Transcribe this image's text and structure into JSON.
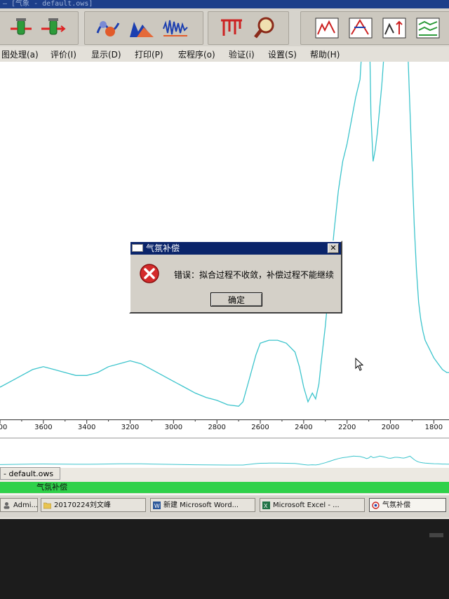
{
  "window": {
    "title": "— [气象 - default.ows]"
  },
  "menu": [
    {
      "label": "图处理(a)"
    },
    {
      "label": "评价(I)"
    },
    {
      "label": "显示(D)"
    },
    {
      "label": "打印(P)"
    },
    {
      "label": "宏程序(o)"
    },
    {
      "label": "验证(i)"
    },
    {
      "label": "设置(S)"
    },
    {
      "label": "帮助(H)"
    }
  ],
  "toolbar_icons": [
    "flask-icon",
    "flask-arrow-icon",
    "spectrum-cloud-icon",
    "spectrum-peaks-icon",
    "spectrum-noise-icon",
    "peaks-bars-icon",
    "magnifier-icon",
    "chart-icon",
    "chart-peak-icon",
    "chart-arrows-icon",
    "chart-stack-icon"
  ],
  "chart_data": {
    "type": "line",
    "xlabel": "",
    "ylabel": "",
    "x_ticks": [
      3600,
      3400,
      3200,
      3000,
      2800,
      2600,
      2400,
      2200,
      2000,
      1800
    ],
    "x_ticks_visible": [
      "00",
      "3600",
      "3400",
      "3200",
      "3000",
      "2800",
      "2600",
      "2400",
      "2200",
      "2000",
      "1800"
    ],
    "xlim": [
      3800,
      1730
    ],
    "axis_reversed": true,
    "series": [
      {
        "color": "#3cc4cc",
        "x": [
          3800,
          3750,
          3700,
          3650,
          3600,
          3550,
          3500,
          3450,
          3400,
          3350,
          3300,
          3250,
          3200,
          3150,
          3100,
          3050,
          3000,
          2950,
          2900,
          2850,
          2800,
          2750,
          2700,
          2680,
          2650,
          2620,
          2600,
          2560,
          2520,
          2480,
          2440,
          2420,
          2400,
          2380,
          2360,
          2345,
          2330,
          2320,
          2300,
          2280,
          2260,
          2240,
          2220,
          2200,
          2190,
          2180,
          2170,
          2160,
          2140,
          2120,
          2110,
          2100,
          2090,
          2080,
          2070,
          2060,
          2050,
          2040,
          2030,
          2020,
          2010,
          2000,
          1990,
          1980,
          1970,
          1960,
          1950,
          1940,
          1930,
          1920,
          1910,
          1900,
          1890,
          1880,
          1870,
          1860,
          1850,
          1840,
          1820,
          1800,
          1780,
          1760,
          1740,
          1730
        ],
        "y": [
          0.05,
          0.07,
          0.09,
          0.11,
          0.12,
          0.11,
          0.1,
          0.09,
          0.09,
          0.1,
          0.12,
          0.13,
          0.14,
          0.13,
          0.11,
          0.09,
          0.07,
          0.05,
          0.03,
          0.015,
          0.005,
          -0.01,
          -0.015,
          0.0,
          0.08,
          0.16,
          0.2,
          0.21,
          0.21,
          0.2,
          0.17,
          0.12,
          0.05,
          0.0,
          0.03,
          0.01,
          0.06,
          0.13,
          0.26,
          0.42,
          0.58,
          0.72,
          0.82,
          0.88,
          0.92,
          0.96,
          1.0,
          1.04,
          1.1,
          1.35,
          1.55,
          1.42,
          0.98,
          0.82,
          0.86,
          0.92,
          1.0,
          1.08,
          1.18,
          1.3,
          1.44,
          1.5,
          1.38,
          1.28,
          1.28,
          1.32,
          1.4,
          1.44,
          1.36,
          1.2,
          1.0,
          0.8,
          0.6,
          0.45,
          0.34,
          0.28,
          0.24,
          0.21,
          0.18,
          0.15,
          0.13,
          0.11,
          0.1,
          0.1
        ]
      }
    ],
    "ylim": [
      -0.06,
      1.16
    ],
    "grid": false
  },
  "doc_tab": {
    "label": "- default.ows"
  },
  "status": {
    "label": "气氛补偿",
    "color": "#2fd14a"
  },
  "taskbar": [
    {
      "label": "Admi...",
      "icon": "user-icon"
    },
    {
      "label": "20170224刘文峰",
      "icon": "folder-icon"
    },
    {
      "label": "新建 Microsoft Word...",
      "icon": "word-icon"
    },
    {
      "label": "Microsoft Excel - ...",
      "icon": "excel-icon"
    },
    {
      "label": "气氛补偿",
      "icon": "app-icon"
    }
  ],
  "dialog": {
    "title": "气氛补偿",
    "message": "错误：拟合过程不收敛，补偿过程不能继续",
    "ok_label": "确定",
    "close_label": "✕"
  },
  "colors": {
    "trace": "#3cc4cc",
    "dialog_title": "#0a246a",
    "error": "#d42b2b"
  }
}
